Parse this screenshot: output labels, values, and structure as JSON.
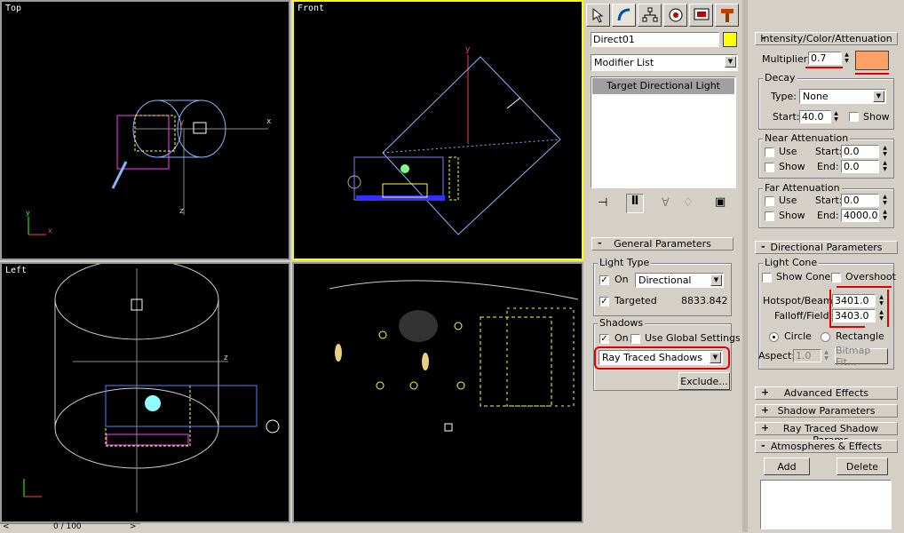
{
  "viewports": {
    "top": {
      "label": "Top"
    },
    "front": {
      "label": "Front"
    },
    "left": {
      "label": "Left"
    }
  },
  "timeslider": {
    "value": "0 / 100"
  },
  "modify_panel": {
    "object_name": "Direct01",
    "object_color": "#ffff00",
    "modifier_list": "Modifier List",
    "stack_item": "Target Directional Light"
  },
  "general": {
    "title": "General Parameters",
    "light_type": {
      "title": "Light Type",
      "on_label": "On",
      "type_value": "Directional",
      "targeted_label": "Targeted",
      "target_distance": "8833.842"
    },
    "shadows": {
      "title": "Shadows",
      "on_label": "On",
      "global_label": "Use Global Settings",
      "type_value": "Ray Traced Shadows",
      "exclude_label": "Exclude..."
    }
  },
  "intensity": {
    "title": "Intensity/Color/Attenuation",
    "multiplier_label": "Multiplier:",
    "multiplier_value": "0.7",
    "color": "#ffa067",
    "decay": {
      "title": "Decay",
      "type_label": "Type:",
      "type_value": "None",
      "start_label": "Start:",
      "start_value": "40.0",
      "show_label": "Show"
    },
    "near": {
      "title": "Near Attenuation",
      "use": "Use",
      "show": "Show",
      "start_label": "Start:",
      "start_value": "0.0",
      "end_label": "End:",
      "end_value": "0.0"
    },
    "far": {
      "title": "Far Attenuation",
      "use": "Use",
      "show": "Show",
      "start_label": "Start:",
      "start_value": "0.0",
      "end_label": "End:",
      "end_value": "4000.0"
    }
  },
  "directional": {
    "title": "Directional Parameters",
    "cone_title": "Light Cone",
    "show_cone": "Show Cone",
    "overshoot": "Overshoot",
    "hotspot_label": "Hotspot/Beam:",
    "hotspot_value": "3401.0",
    "falloff_label": "Falloff/Field:",
    "falloff_value": "3403.0",
    "circle": "Circle",
    "rectangle": "Rectangle",
    "aspect_label": "Aspect:",
    "aspect_value": "1.0",
    "bitmap_label": "Bitmap Fit..."
  },
  "rollouts": {
    "advanced": "Advanced Effects",
    "shadow_params": "Shadow Parameters",
    "raytrace": "Ray Traced Shadow Params",
    "atmos": "Atmospheres & Effects",
    "add": "Add",
    "delete": "Delete"
  }
}
